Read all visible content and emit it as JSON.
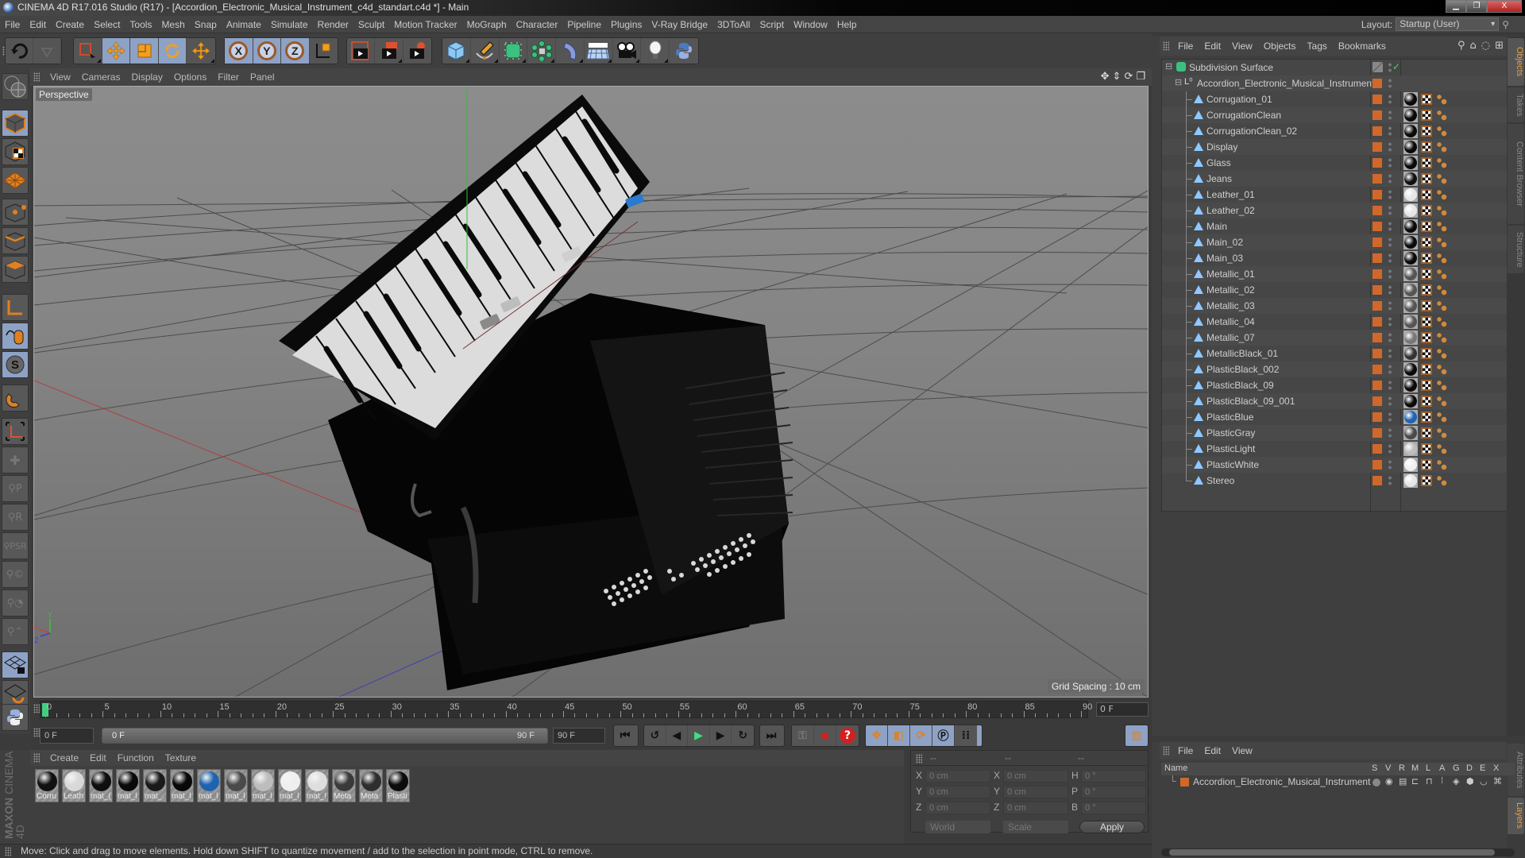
{
  "window": {
    "title": "CINEMA 4D R17.016 Studio (R17) - [Accordion_Electronic_Musical_Instrument_c4d_standart.c4d *] - Main",
    "buttons": [
      "minimize",
      "restore",
      "close"
    ]
  },
  "menubar": {
    "items": [
      "File",
      "Edit",
      "Create",
      "Select",
      "Tools",
      "Mesh",
      "Snap",
      "Animate",
      "Simulate",
      "Render",
      "Sculpt",
      "Motion Tracker",
      "MoGraph",
      "Character",
      "Pipeline",
      "Plugins",
      "V-Ray Bridge",
      "3DToAll",
      "Script",
      "Window",
      "Help"
    ],
    "layout_label": "Layout:",
    "layout_value": "Startup (User)"
  },
  "toolbar": {
    "axis_x": "X",
    "axis_y": "Y",
    "axis_z": "Z",
    "tools": [
      "undo",
      "redo",
      "live-selection",
      "move",
      "scale",
      "rotate",
      "last-tool",
      "x-axis-lock",
      "y-axis-lock",
      "z-axis-lock",
      "coordinate-system",
      "render-view",
      "render-picture-viewer",
      "render-settings",
      "cube",
      "pen",
      "subdivision-surface",
      "cloner",
      "deformer",
      "floor",
      "camera",
      "light",
      "python"
    ]
  },
  "viewport": {
    "menu": [
      "View",
      "Cameras",
      "Display",
      "Options",
      "Filter",
      "Panel"
    ],
    "camera_label": "Perspective",
    "grid_spacing": "Grid Spacing : 10 cm",
    "axis_labels": {
      "x": "X",
      "y": "Y",
      "z": "Z"
    }
  },
  "timeline": {
    "ticks": [
      "0",
      "5",
      "10",
      "15",
      "20",
      "25",
      "30",
      "35",
      "40",
      "45",
      "50",
      "55",
      "60",
      "65",
      "70",
      "75",
      "80",
      "85",
      "90"
    ],
    "current_frame": "0 F",
    "start_field": "0 F",
    "range_start": "0 F",
    "range_end": "90 F",
    "end_field": "90 F"
  },
  "materials": {
    "menu": [
      "Create",
      "Edit",
      "Function",
      "Texture"
    ],
    "items": [
      {
        "label": "Corru",
        "color": "#111111"
      },
      {
        "label": "Leath",
        "color": "#d8d8d8"
      },
      {
        "label": "mat_(",
        "color": "#0e0e0e"
      },
      {
        "label": "mat_l",
        "color": "#0a0a0a"
      },
      {
        "label": "mat_.",
        "color": "#1a1a1a"
      },
      {
        "label": "mat_l",
        "color": "#080808"
      },
      {
        "label": "mat_l",
        "color": "#1f63b0"
      },
      {
        "label": "mat_l",
        "color": "#4a4a4a"
      },
      {
        "label": "mat_l",
        "color": "#bdbdbd"
      },
      {
        "label": "mat_l",
        "color": "#efefef"
      },
      {
        "label": "mat_!",
        "color": "#dedede"
      },
      {
        "label": "Meta",
        "color": "#3a3a3a"
      },
      {
        "label": "Meta",
        "color": "#2e2e2e"
      },
      {
        "label": "Plasti",
        "color": "#0c0c0c"
      }
    ],
    "brand_top": "MAXON",
    "brand_bottom": "CINEMA 4D"
  },
  "coordinates": {
    "headers": [
      "--",
      "--",
      "--"
    ],
    "rows": [
      {
        "l1": "X",
        "v1": "0 cm",
        "l2": "X",
        "v2": "0 cm",
        "l3": "H",
        "v3": "0 °"
      },
      {
        "l1": "Y",
        "v1": "0 cm",
        "l2": "Y",
        "v2": "0 cm",
        "l3": "P",
        "v3": "0 °"
      },
      {
        "l1": "Z",
        "v1": "0 cm",
        "l2": "Z",
        "v2": "0 cm",
        "l3": "B",
        "v3": "0 °"
      }
    ],
    "space": "World",
    "mode": "Scale",
    "apply": "Apply"
  },
  "status": {
    "text": "Move: Click and drag to move elements. Hold down SHIFT to quantize movement / add to the selection in point mode, CTRL to remove."
  },
  "objects_panel": {
    "menu": [
      "File",
      "Edit",
      "View",
      "Objects",
      "Tags",
      "Bookmarks"
    ],
    "root": "Subdivision Surface",
    "group": "Accordion_Electronic_Musical_Instrument",
    "children": [
      {
        "name": "Corrugation_01",
        "mat": "#0a0a0a"
      },
      {
        "name": "CorrugationClean",
        "mat": "#0a0a0a"
      },
      {
        "name": "CorrugationClean_02",
        "mat": "#0a0a0a"
      },
      {
        "name": "Display",
        "mat": "#0a0a0a"
      },
      {
        "name": "Glass",
        "mat": "#0a0a0a"
      },
      {
        "name": "Jeans",
        "mat": "#111111"
      },
      {
        "name": "Leather_01",
        "mat": "#e6e6e6"
      },
      {
        "name": "Leather_02",
        "mat": "#e6e6e6"
      },
      {
        "name": "Main",
        "mat": "#0a0a0a"
      },
      {
        "name": "Main_02",
        "mat": "#0a0a0a"
      },
      {
        "name": "Main_03",
        "mat": "#0a0a0a"
      },
      {
        "name": "Metallic_01",
        "mat": "#555555"
      },
      {
        "name": "Metallic_02",
        "mat": "#555555"
      },
      {
        "name": "Metallic_03",
        "mat": "#555555"
      },
      {
        "name": "Metallic_04",
        "mat": "#555555"
      },
      {
        "name": "Metallic_07",
        "mat": "#777777"
      },
      {
        "name": "MetallicBlack_01",
        "mat": "#333333"
      },
      {
        "name": "PlasticBlack_002",
        "mat": "#0a0a0a"
      },
      {
        "name": "PlasticBlack_09",
        "mat": "#0a0a0a"
      },
      {
        "name": "PlasticBlack_09_001",
        "mat": "#0a0a0a"
      },
      {
        "name": "PlasticBlue",
        "mat": "#1f63b0"
      },
      {
        "name": "PlasticGray",
        "mat": "#4a4a4a"
      },
      {
        "name": "PlasticLight",
        "mat": "#bdbdbd"
      },
      {
        "name": "PlasticWhite",
        "mat": "#f0f0f0"
      },
      {
        "name": "Stereo",
        "mat": "#e6e6e6"
      }
    ],
    "layer_color": "#d0682a"
  },
  "right_tabs": {
    "top": [
      "Objects",
      "Takes",
      "Content Browser",
      "Structure"
    ],
    "bottom": [
      "Attributes",
      "Layers"
    ]
  },
  "layers_panel": {
    "menu": [
      "File",
      "Edit",
      "View"
    ],
    "columns": [
      "Name",
      "S",
      "V",
      "R",
      "M",
      "L",
      "A",
      "G",
      "D",
      "E",
      "X"
    ],
    "rows": [
      {
        "name": "Accordion_Electronic_Musical_Instrument",
        "color": "#d0682a"
      }
    ]
  }
}
